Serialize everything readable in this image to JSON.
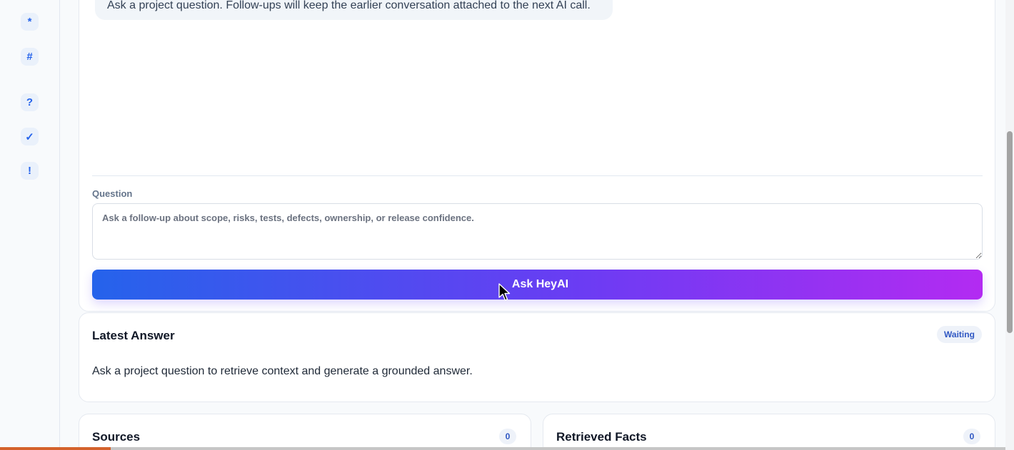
{
  "rail": {
    "buttons": [
      {
        "glyph": "*",
        "icon": "asterisk-icon"
      },
      {
        "glyph": "#",
        "icon": "hash-icon"
      },
      {
        "glyph": "?",
        "icon": "question-icon"
      },
      {
        "glyph": "✓",
        "icon": "check-icon"
      },
      {
        "glyph": "!",
        "icon": "alert-icon"
      }
    ]
  },
  "chat": {
    "intro_message": "Ask a project question. Follow-ups will keep the earlier conversation attached to the next AI call.",
    "question_label": "Question",
    "question_placeholder": "Ask a follow-up about scope, risks, tests, defects, ownership, or release confidence.",
    "question_value": "",
    "ask_button_label": "Ask HeyAI"
  },
  "answer": {
    "title": "Latest Answer",
    "status": "Waiting",
    "text": "Ask a project question to retrieve context and generate a grounded answer."
  },
  "sources": {
    "title": "Sources",
    "count": "0"
  },
  "facts": {
    "title": "Retrieved Facts",
    "count": "0"
  },
  "colors": {
    "accent_blue": "#2563eb",
    "accent_purple": "#b32bf2",
    "progress_orange": "#d4622c"
  },
  "page_progress_fraction": 0.11
}
